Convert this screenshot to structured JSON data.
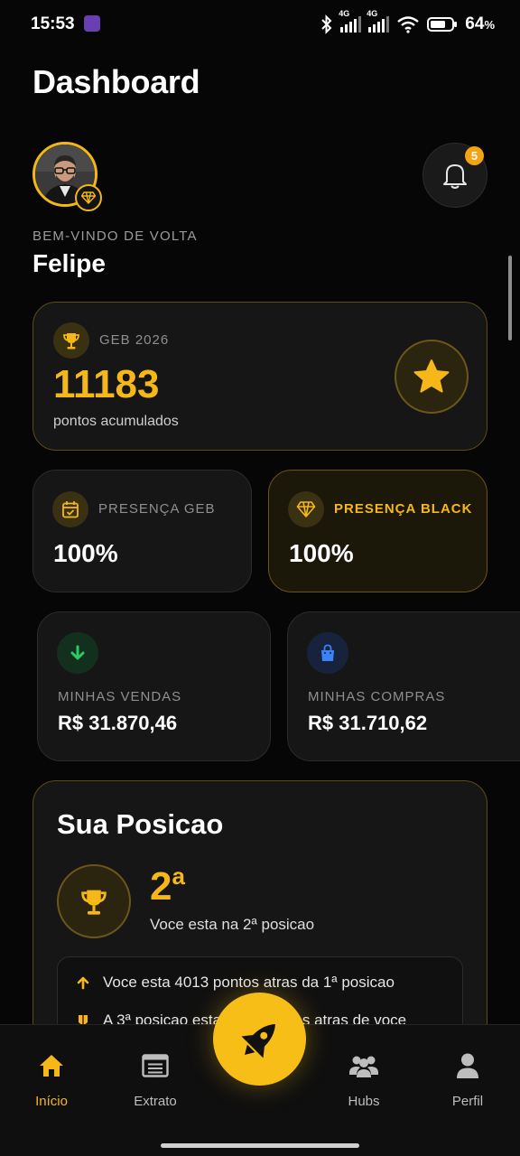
{
  "status_bar": {
    "time": "15:53",
    "battery_percent": "64",
    "battery_unit": "%",
    "signal_1": "4G",
    "signal_2": "4G"
  },
  "header": {
    "title": "Dashboard"
  },
  "user": {
    "welcome_label": "BEM-VINDO DE VOLTA",
    "name": "Felipe",
    "notification_count": "5"
  },
  "points_card": {
    "label": "GEB 2026",
    "value": "11183",
    "subtitle": "pontos acumulados"
  },
  "presence": {
    "geb": {
      "label": "PRESENÇA GEB",
      "value": "100%"
    },
    "black": {
      "label": "PRESENÇA BLACK",
      "value": "100%"
    }
  },
  "finance": {
    "sales": {
      "label": "MINHAS VENDAS",
      "value": "R$ 31.870,46"
    },
    "purchases": {
      "label": "MINHAS COMPRAS",
      "value": "R$ 31.710,62"
    }
  },
  "ranking": {
    "title": "Sua Posicao",
    "position": "2",
    "position_suffix": "a",
    "description": "Voce esta na 2ª posicao",
    "info": [
      "Voce esta 4013 pontos atras da 1ª posicao",
      "A 3ª posicao esta 2340 pontos atras de voce"
    ]
  },
  "nav": {
    "items": [
      {
        "label": "Início",
        "icon": "home-icon",
        "active": true
      },
      {
        "label": "Extrato",
        "icon": "receipt-icon",
        "active": false
      },
      {
        "label": "Hubs",
        "icon": "group-icon",
        "active": false
      },
      {
        "label": "Perfil",
        "icon": "user-icon",
        "active": false
      }
    ],
    "center_icon": "rocket-icon"
  },
  "colors": {
    "accent": "#f6b819",
    "background": "#060606",
    "card": "#161616",
    "sales_green": "#2ec866",
    "purchases_blue": "#3b82f6"
  }
}
